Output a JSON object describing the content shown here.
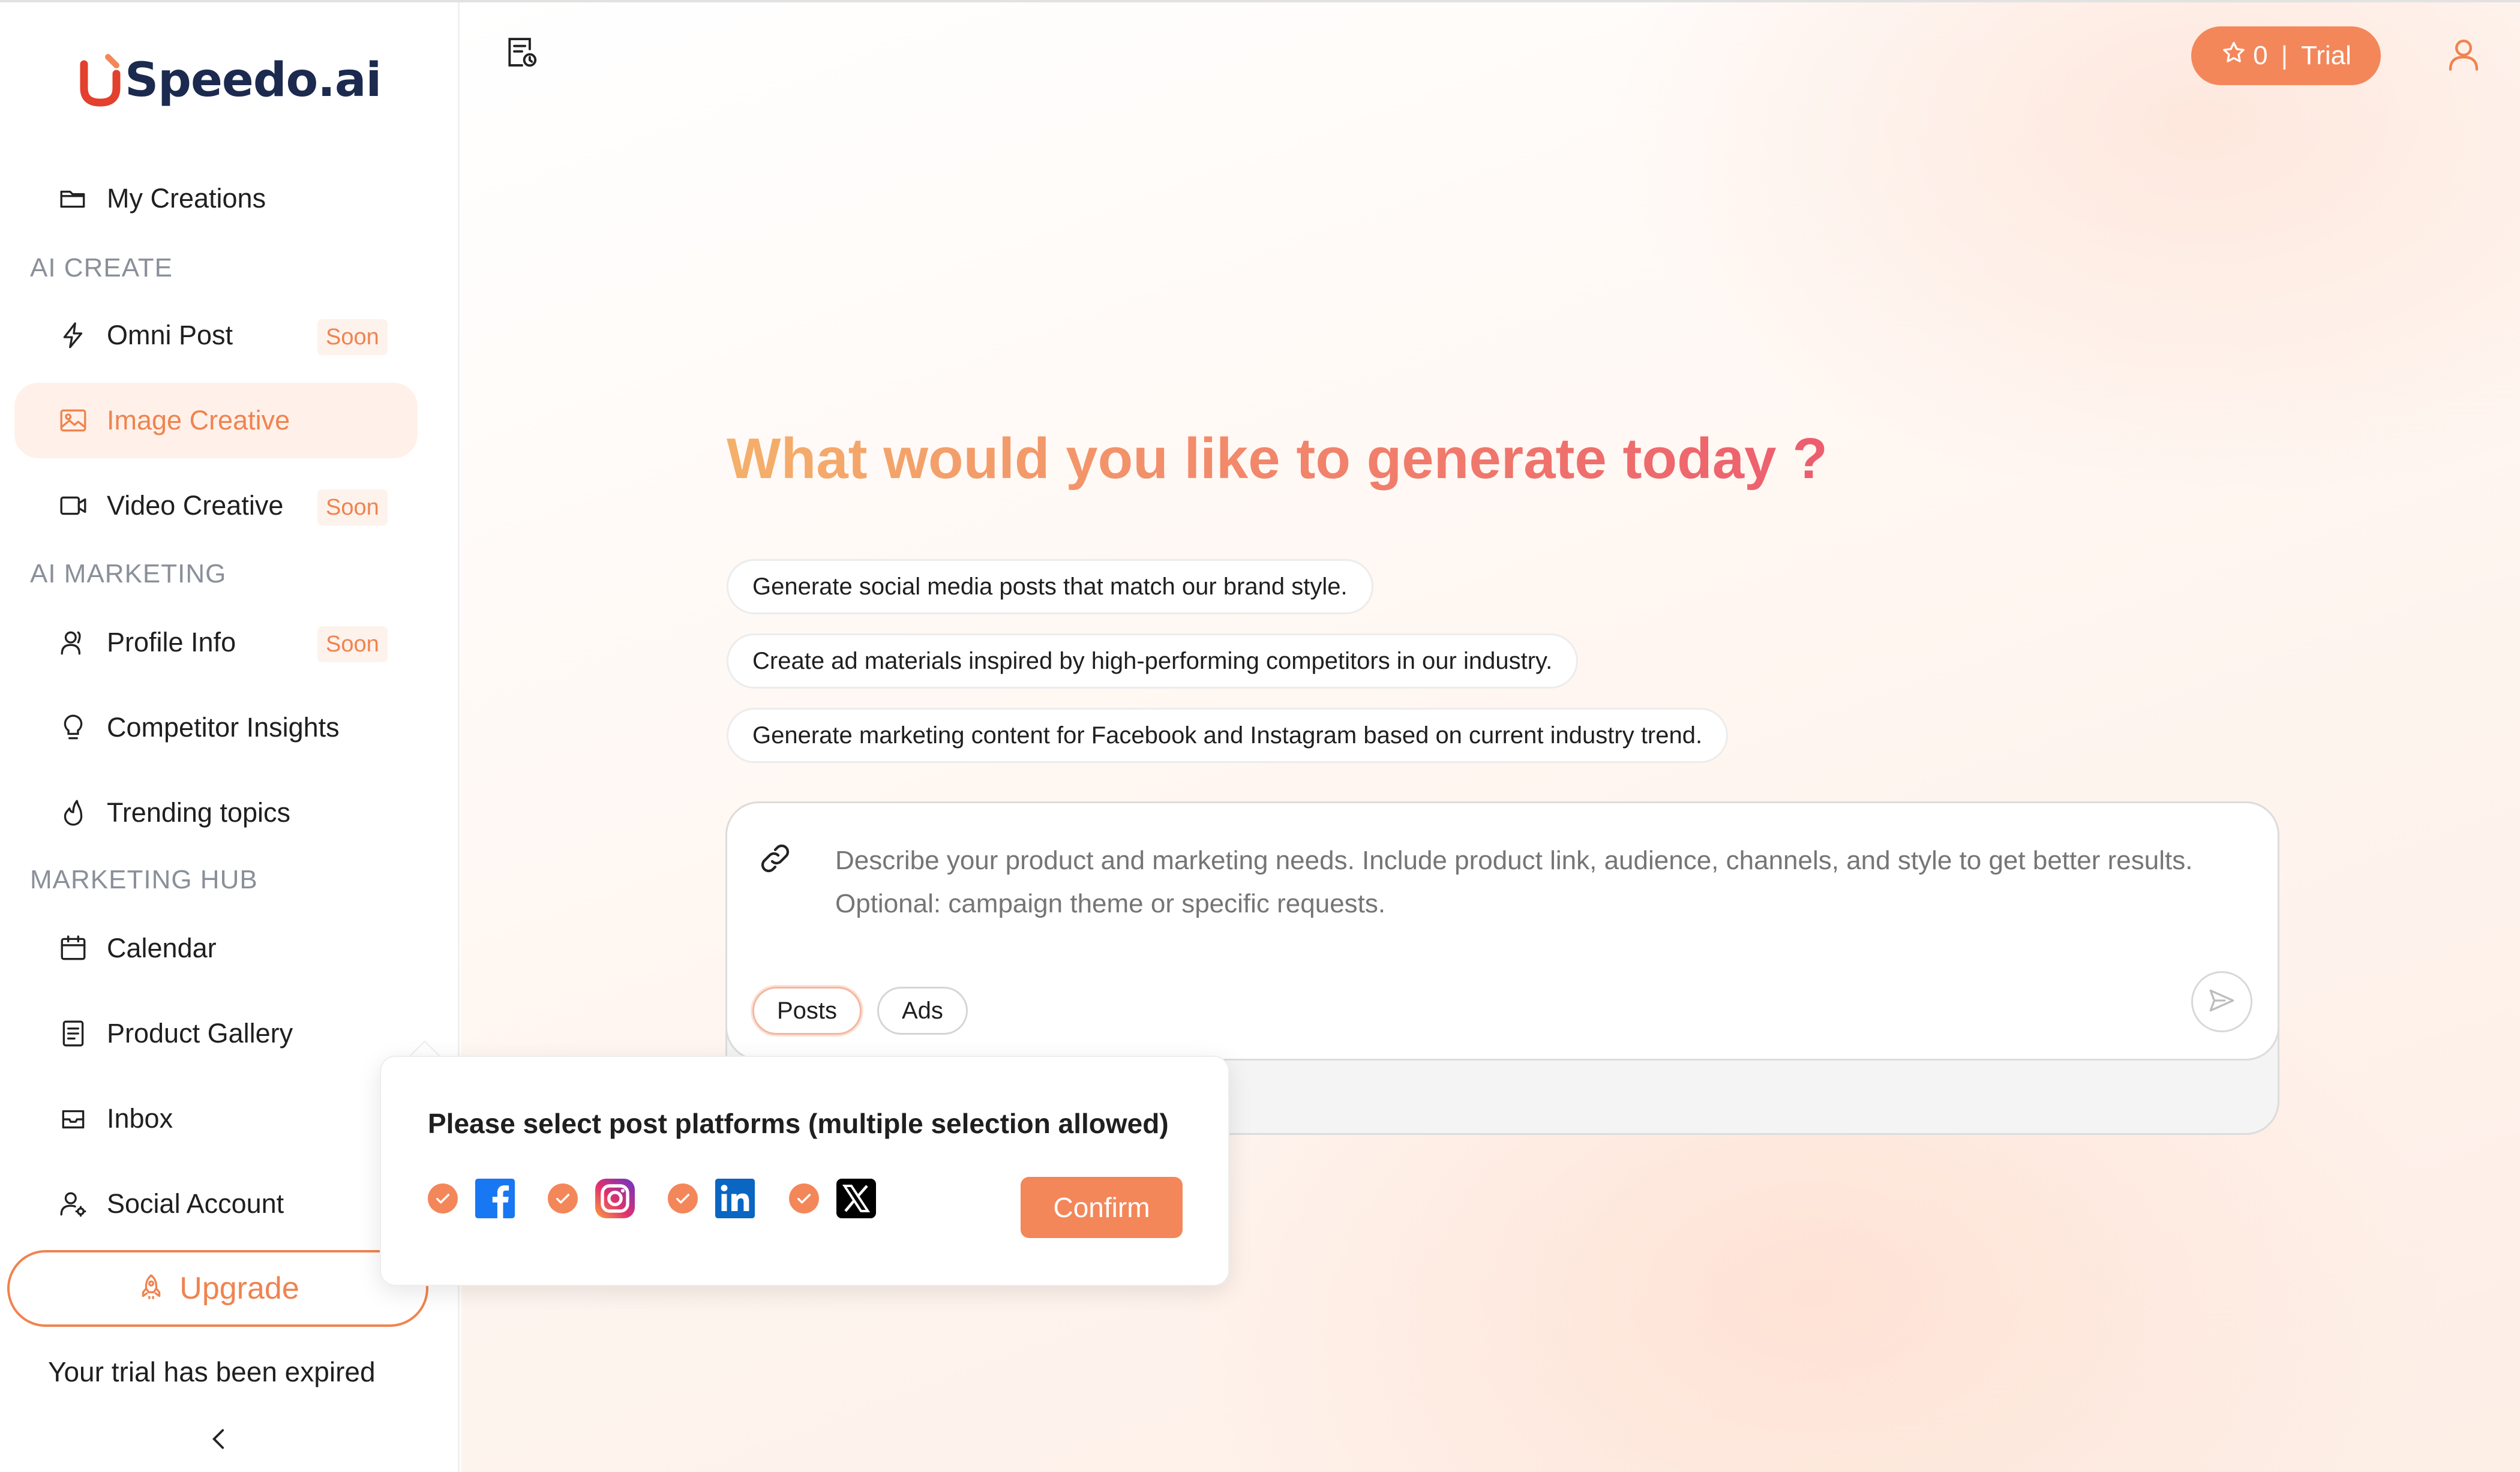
{
  "brand": {
    "name": "Speedo.ai",
    "accent": "#f3875a"
  },
  "sidebar": {
    "my_creations": "My Creations",
    "sections": {
      "ai_create": "AI CREATE",
      "ai_marketing": "AI MARKETING",
      "marketing_hub": "MARKETING HUB"
    },
    "items": {
      "omni_post": {
        "label": "Omni Post",
        "badge": "Soon"
      },
      "image_creative": {
        "label": "Image Creative"
      },
      "video_creative": {
        "label": "Video Creative",
        "badge": "Soon"
      },
      "profile_info": {
        "label": "Profile Info",
        "badge": "Soon"
      },
      "competitor_insights": {
        "label": "Competitor Insights"
      },
      "trending_topics": {
        "label": "Trending topics"
      },
      "calendar": {
        "label": "Calendar"
      },
      "product_gallery": {
        "label": "Product Gallery"
      },
      "inbox": {
        "label": "Inbox"
      },
      "social_account": {
        "label": "Social Account"
      }
    },
    "upgrade_label": "Upgrade",
    "trial_expired_text": "Your trial has been expired"
  },
  "header": {
    "credits": "0",
    "separator": "|",
    "plan": "Trial"
  },
  "main": {
    "headline": "What would you like to generate today ?",
    "suggestions": [
      "Generate social media posts that match our brand style.",
      "Create ad materials inspired by high-performing competitors in our industry.",
      "Generate marketing content for Facebook and Instagram based on current industry trend."
    ],
    "prompt_placeholder": "Describe your product and marketing needs. Include product link, audience, channels, and style to get better results. Optional: campaign theme or specific requests.",
    "modes": {
      "posts": "Posts",
      "ads": "Ads"
    },
    "active_mode": "Posts"
  },
  "popover": {
    "title": "Please select post platforms (multiple selection allowed)",
    "platforms": [
      {
        "name": "Facebook",
        "icon": "facebook-icon",
        "checked": true
      },
      {
        "name": "Instagram",
        "icon": "instagram-icon",
        "checked": true
      },
      {
        "name": "LinkedIn",
        "icon": "linkedin-icon",
        "checked": true
      },
      {
        "name": "X",
        "icon": "x-icon",
        "checked": true
      }
    ],
    "confirm_label": "Confirm"
  }
}
